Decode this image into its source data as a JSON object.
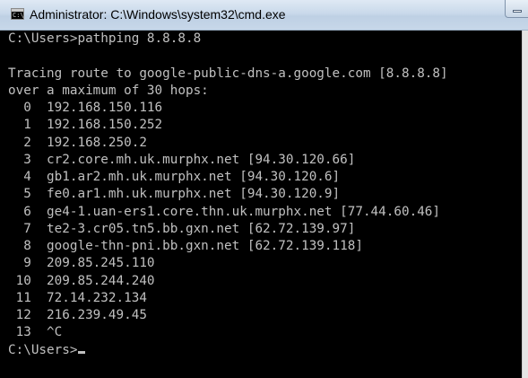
{
  "window": {
    "title": "Administrator: C:\\Windows\\system32\\cmd.exe",
    "icon": "cmd-icon",
    "icon_glyph": "C:\\"
  },
  "console": {
    "lines": [
      "C:\\Users>pathping 8.8.8.8",
      "",
      "Tracing route to google-public-dns-a.google.com [8.8.8.8]",
      "over a maximum of 30 hops:",
      "  0  192.168.150.116",
      "  1  192.168.150.252",
      "  2  192.168.250.2",
      "  3  cr2.core.mh.uk.murphx.net [94.30.120.66]",
      "  4  gb1.ar2.mh.uk.murphx.net [94.30.120.6]",
      "  5  fe0.ar1.mh.uk.murphx.net [94.30.120.9]",
      "  6  ge4-1.uan-ers1.core.thn.uk.murphx.net [77.44.60.46]",
      "  7  te2-3.cr05.tn5.bb.gxn.net [62.72.139.97]",
      "  8  google-thn-pni.bb.gxn.net [62.72.139.118]",
      "  9  209.85.245.110",
      " 10  209.85.244.240",
      " 11  72.14.232.134",
      " 12  216.239.49.45",
      " 13  ^C"
    ],
    "prompt": "C:\\Users>"
  },
  "colors": {
    "console_background": "#000000",
    "console_text": "#c0c0c0",
    "titlebar": "#c9d9ea"
  }
}
